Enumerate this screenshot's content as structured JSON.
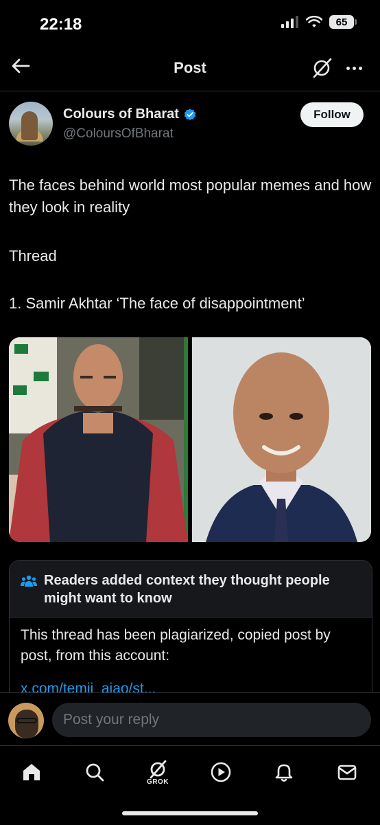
{
  "status_bar": {
    "time": "22:18",
    "battery": "65"
  },
  "header": {
    "title": "Post"
  },
  "author": {
    "name": "Colours of Bharat",
    "handle": "@ColoursOfBharat",
    "follow_label": "Follow"
  },
  "post": {
    "lines": [
      "The faces behind world most popular memes and how they look in reality",
      "Thread",
      "1. Samir Akhtar ‘The face of disappointment’"
    ]
  },
  "community_note": {
    "title": "Readers added context they thought people might want to know",
    "body": "This thread has been plagiarized, copied post by post, from this account:",
    "link": "x.com/temii_ajao/st..."
  },
  "reply": {
    "placeholder": "Post your reply"
  },
  "nav": {
    "grok_label": "GROK",
    "items": [
      "home-icon",
      "search-icon",
      "grok-icon",
      "video-icon",
      "notifications-icon",
      "messages-icon"
    ]
  },
  "colors": {
    "accent": "#1d9bf0",
    "background": "#000000",
    "text": "#e7e9ea",
    "muted": "#71767b"
  }
}
